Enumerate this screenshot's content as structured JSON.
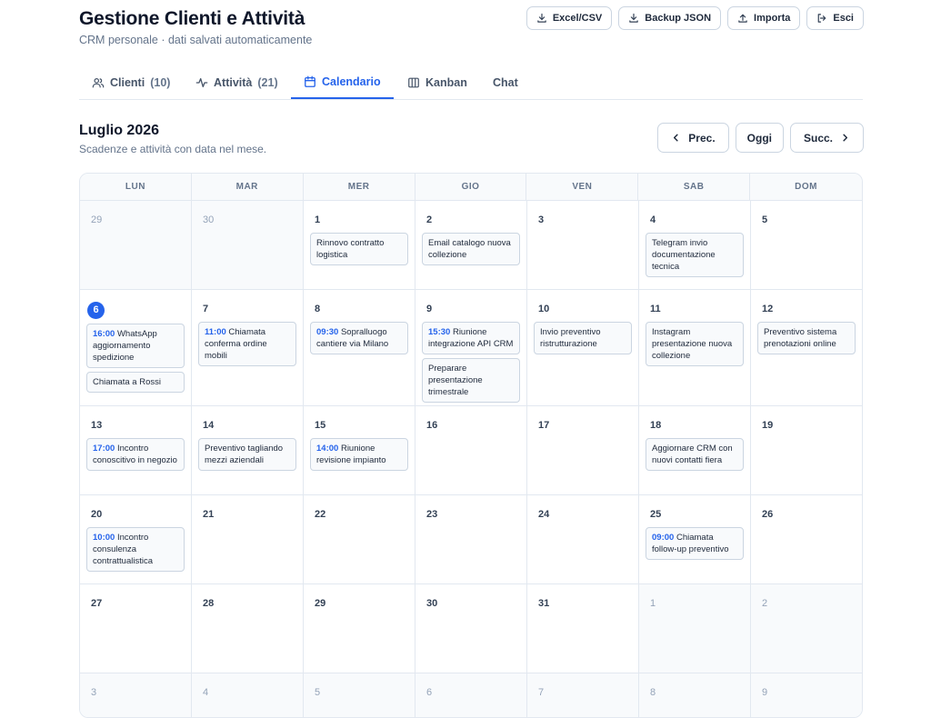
{
  "header": {
    "title": "Gestione Clienti e Attività",
    "subtitle": "CRM personale · dati salvati automaticamente",
    "actions": [
      {
        "label": "Excel/CSV",
        "icon": "download-icon"
      },
      {
        "label": "Backup JSON",
        "icon": "download-icon"
      },
      {
        "label": "Importa",
        "icon": "upload-icon"
      },
      {
        "label": "Esci",
        "icon": "logout-icon"
      }
    ]
  },
  "tabs": [
    {
      "label": "Clienti",
      "count": "(10)",
      "icon": "users-icon"
    },
    {
      "label": "Attività",
      "count": "(21)",
      "icon": "activity-icon"
    },
    {
      "label": "Calendario",
      "count": "",
      "icon": "calendar-icon",
      "active": true
    },
    {
      "label": "Kanban",
      "count": "",
      "icon": "kanban-icon"
    },
    {
      "label": "Chat",
      "count": "",
      "icon": ""
    }
  ],
  "calendar": {
    "month_title": "Luglio 2026",
    "month_subtitle": "Scadenze e attività con data nel mese.",
    "prev_label": "Prec.",
    "today_label": "Oggi",
    "next_label": "Succ.",
    "weekdays": [
      "LUN",
      "MAR",
      "MER",
      "GIO",
      "VEN",
      "SAB",
      "DOM"
    ],
    "weeks": [
      [
        {
          "day": "29",
          "out": true,
          "events": []
        },
        {
          "day": "30",
          "out": true,
          "events": []
        },
        {
          "day": "1",
          "events": [
            {
              "time": "",
              "text": "Rinnovo contratto logistica"
            }
          ]
        },
        {
          "day": "2",
          "events": [
            {
              "time": "",
              "text": "Email catalogo nuova collezione"
            }
          ]
        },
        {
          "day": "3",
          "events": []
        },
        {
          "day": "4",
          "events": [
            {
              "time": "",
              "text": "Telegram invio documentazione tecnica"
            }
          ]
        },
        {
          "day": "5",
          "events": []
        }
      ],
      [
        {
          "day": "6",
          "today": true,
          "events": [
            {
              "time": "16:00",
              "text": "WhatsApp aggiornamento spedizione"
            },
            {
              "time": "",
              "text": "Chiamata a Rossi"
            }
          ]
        },
        {
          "day": "7",
          "events": [
            {
              "time": "11:00",
              "text": "Chiamata conferma ordine mobili"
            }
          ]
        },
        {
          "day": "8",
          "events": [
            {
              "time": "09:30",
              "text": "Sopralluogo cantiere via Milano"
            }
          ]
        },
        {
          "day": "9",
          "events": [
            {
              "time": "15:30",
              "text": "Riunione integrazione API CRM"
            },
            {
              "time": "",
              "text": "Preparare presentazione trimestrale"
            }
          ]
        },
        {
          "day": "10",
          "events": [
            {
              "time": "",
              "text": "Invio preventivo ristrutturazione"
            }
          ]
        },
        {
          "day": "11",
          "events": [
            {
              "time": "",
              "text": "Instagram presentazione nuova collezione"
            }
          ]
        },
        {
          "day": "12",
          "events": [
            {
              "time": "",
              "text": "Preventivo sistema prenotazioni online"
            }
          ]
        }
      ],
      [
        {
          "day": "13",
          "events": [
            {
              "time": "17:00",
              "text": "Incontro conoscitivo in negozio"
            }
          ]
        },
        {
          "day": "14",
          "events": [
            {
              "time": "",
              "text": "Preventivo tagliando mezzi aziendali"
            }
          ]
        },
        {
          "day": "15",
          "events": [
            {
              "time": "14:00",
              "text": "Riunione revisione impianto"
            }
          ]
        },
        {
          "day": "16",
          "events": []
        },
        {
          "day": "17",
          "events": []
        },
        {
          "day": "18",
          "events": [
            {
              "time": "",
              "text": "Aggiornare CRM con nuovi contatti fiera"
            }
          ]
        },
        {
          "day": "19",
          "events": []
        }
      ],
      [
        {
          "day": "20",
          "events": [
            {
              "time": "10:00",
              "text": "Incontro consulenza contrattualistica"
            }
          ]
        },
        {
          "day": "21",
          "events": []
        },
        {
          "day": "22",
          "events": []
        },
        {
          "day": "23",
          "events": []
        },
        {
          "day": "24",
          "events": []
        },
        {
          "day": "25",
          "events": [
            {
              "time": "09:00",
              "text": "Chiamata follow-up preventivo"
            }
          ]
        },
        {
          "day": "26",
          "events": []
        }
      ],
      [
        {
          "day": "27",
          "events": []
        },
        {
          "day": "28",
          "events": []
        },
        {
          "day": "29",
          "events": []
        },
        {
          "day": "30",
          "events": []
        },
        {
          "day": "31",
          "events": []
        },
        {
          "day": "1",
          "out": true,
          "events": []
        },
        {
          "day": "2",
          "out": true,
          "events": []
        }
      ],
      [
        {
          "day": "3",
          "out": true,
          "events": []
        },
        {
          "day": "4",
          "out": true,
          "events": []
        },
        {
          "day": "5",
          "out": true,
          "events": []
        },
        {
          "day": "6",
          "out": true,
          "events": []
        },
        {
          "day": "7",
          "out": true,
          "events": []
        },
        {
          "day": "8",
          "out": true,
          "events": []
        },
        {
          "day": "9",
          "out": true,
          "events": []
        }
      ]
    ]
  }
}
